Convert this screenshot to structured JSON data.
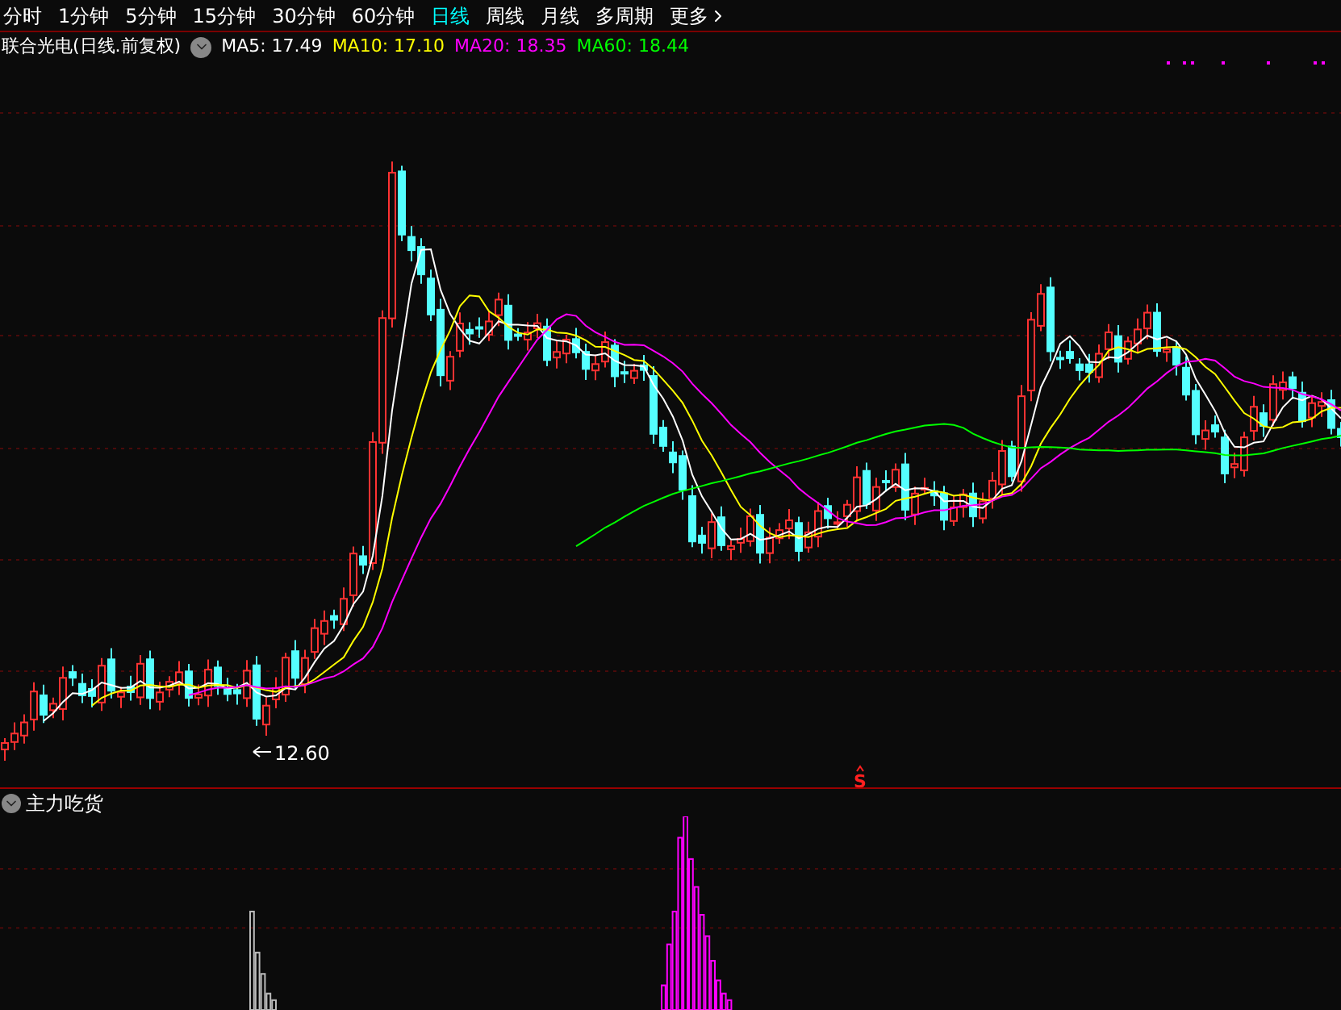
{
  "tabs": [
    {
      "label": "分时",
      "selected": false
    },
    {
      "label": "1分钟",
      "selected": false
    },
    {
      "label": "5分钟",
      "selected": false
    },
    {
      "label": "15分钟",
      "selected": false
    },
    {
      "label": "30分钟",
      "selected": false
    },
    {
      "label": "60分钟",
      "selected": false
    },
    {
      "label": "日线",
      "selected": true
    },
    {
      "label": "周线",
      "selected": false
    },
    {
      "label": "月线",
      "selected": false
    },
    {
      "label": "多周期",
      "selected": false
    },
    {
      "label": "更多",
      "selected": false
    }
  ],
  "legend": {
    "title": "联合光电(日线.前复权)",
    "moving_averages": [
      {
        "label": "MA5: 17.49",
        "color": "#ffffff"
      },
      {
        "label": "MA10: 17.10",
        "color": "#ffff00"
      },
      {
        "label": "MA20: 18.35",
        "color": "#ff00ff"
      },
      {
        "label": "MA60: 18.44",
        "color": "#00ff00"
      }
    ]
  },
  "chart": {
    "low_label": "12.60",
    "signal_marker": "S"
  },
  "indicator": {
    "title": "主力吃货"
  }
}
